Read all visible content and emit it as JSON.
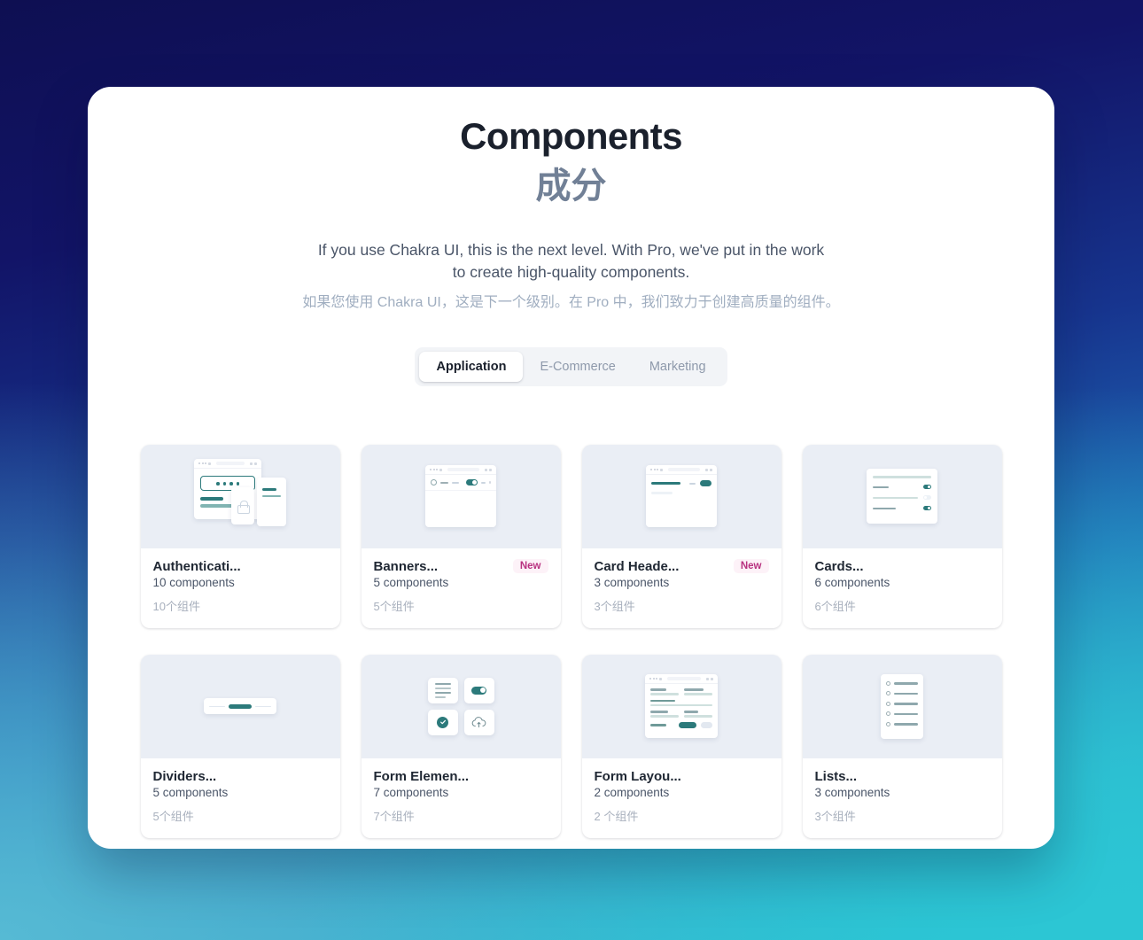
{
  "page": {
    "title": "Components",
    "title_cn": "成分",
    "subtitle": "If you use Chakra UI, this is the next level. With Pro, we've put in the work to create high-quality components.",
    "subtitle_cn": "如果您使用 Chakra UI，这是下一个级别。在 Pro 中，我们致力于创建高质量的组件。",
    "background_gradient_from": "#0e0f52",
    "background_gradient_to": "#2dc5d5",
    "accent_color": "#2c7a7b",
    "badge_color": "#b83280"
  },
  "tabs": [
    {
      "label": "Application",
      "active": true
    },
    {
      "label": "E-Commerce",
      "active": false
    },
    {
      "label": "Marketing",
      "active": false
    }
  ],
  "cards": [
    {
      "title": "Authenticati...",
      "count": "10 components",
      "count_cn": "10个组件",
      "badge": "",
      "thumb": "authentication-thumbnail"
    },
    {
      "title": "Banners...",
      "count": "5 components",
      "count_cn": "5个组件",
      "badge": "New",
      "thumb": "banners-thumbnail"
    },
    {
      "title": "Card Heade...",
      "count": "3 components",
      "count_cn": "3个组件",
      "badge": "New",
      "thumb": "card-headers-thumbnail"
    },
    {
      "title": "Cards...",
      "count": "6 components",
      "count_cn": "6个组件",
      "badge": "",
      "thumb": "cards-thumbnail"
    },
    {
      "title": "Dividers...",
      "count": "5 components",
      "count_cn": "5个组件",
      "badge": "",
      "thumb": "dividers-thumbnail"
    },
    {
      "title": "Form Elemen...",
      "count": "7 components",
      "count_cn": "7个组件",
      "badge": "",
      "thumb": "form-elements-thumbnail"
    },
    {
      "title": "Form Layou...",
      "count": "2 components",
      "count_cn": "2 个组件",
      "badge": "",
      "thumb": "form-layouts-thumbnail"
    },
    {
      "title": "Lists...",
      "count": "3 components",
      "count_cn": "3个组件",
      "badge": "",
      "thumb": "lists-thumbnail"
    }
  ]
}
